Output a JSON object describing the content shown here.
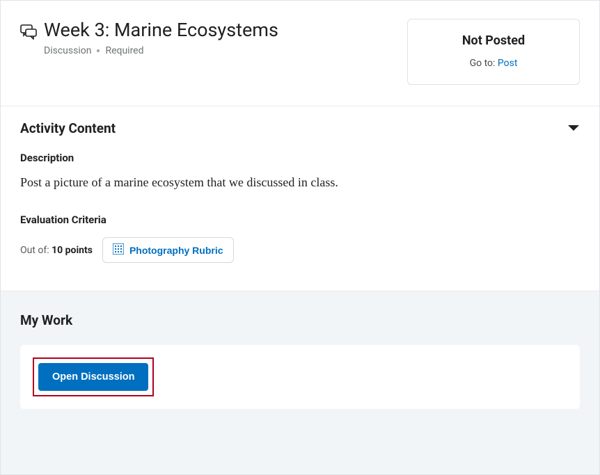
{
  "header": {
    "title": "Week 3: Marine Ecosystems",
    "type_label": "Discussion",
    "required_label": "Required"
  },
  "status": {
    "title": "Not Posted",
    "goto_label": "Go to:",
    "goto_link": "Post"
  },
  "content": {
    "section_title": "Activity Content",
    "description_label": "Description",
    "description_text": "Post a picture of a marine ecosystem that we discussed in class.",
    "eval_label": "Evaluation Criteria",
    "out_of_label": "Out of:",
    "points_text": "10 points",
    "rubric_label": "Photography Rubric"
  },
  "mywork": {
    "title": "My Work",
    "open_button": "Open Discussion"
  }
}
